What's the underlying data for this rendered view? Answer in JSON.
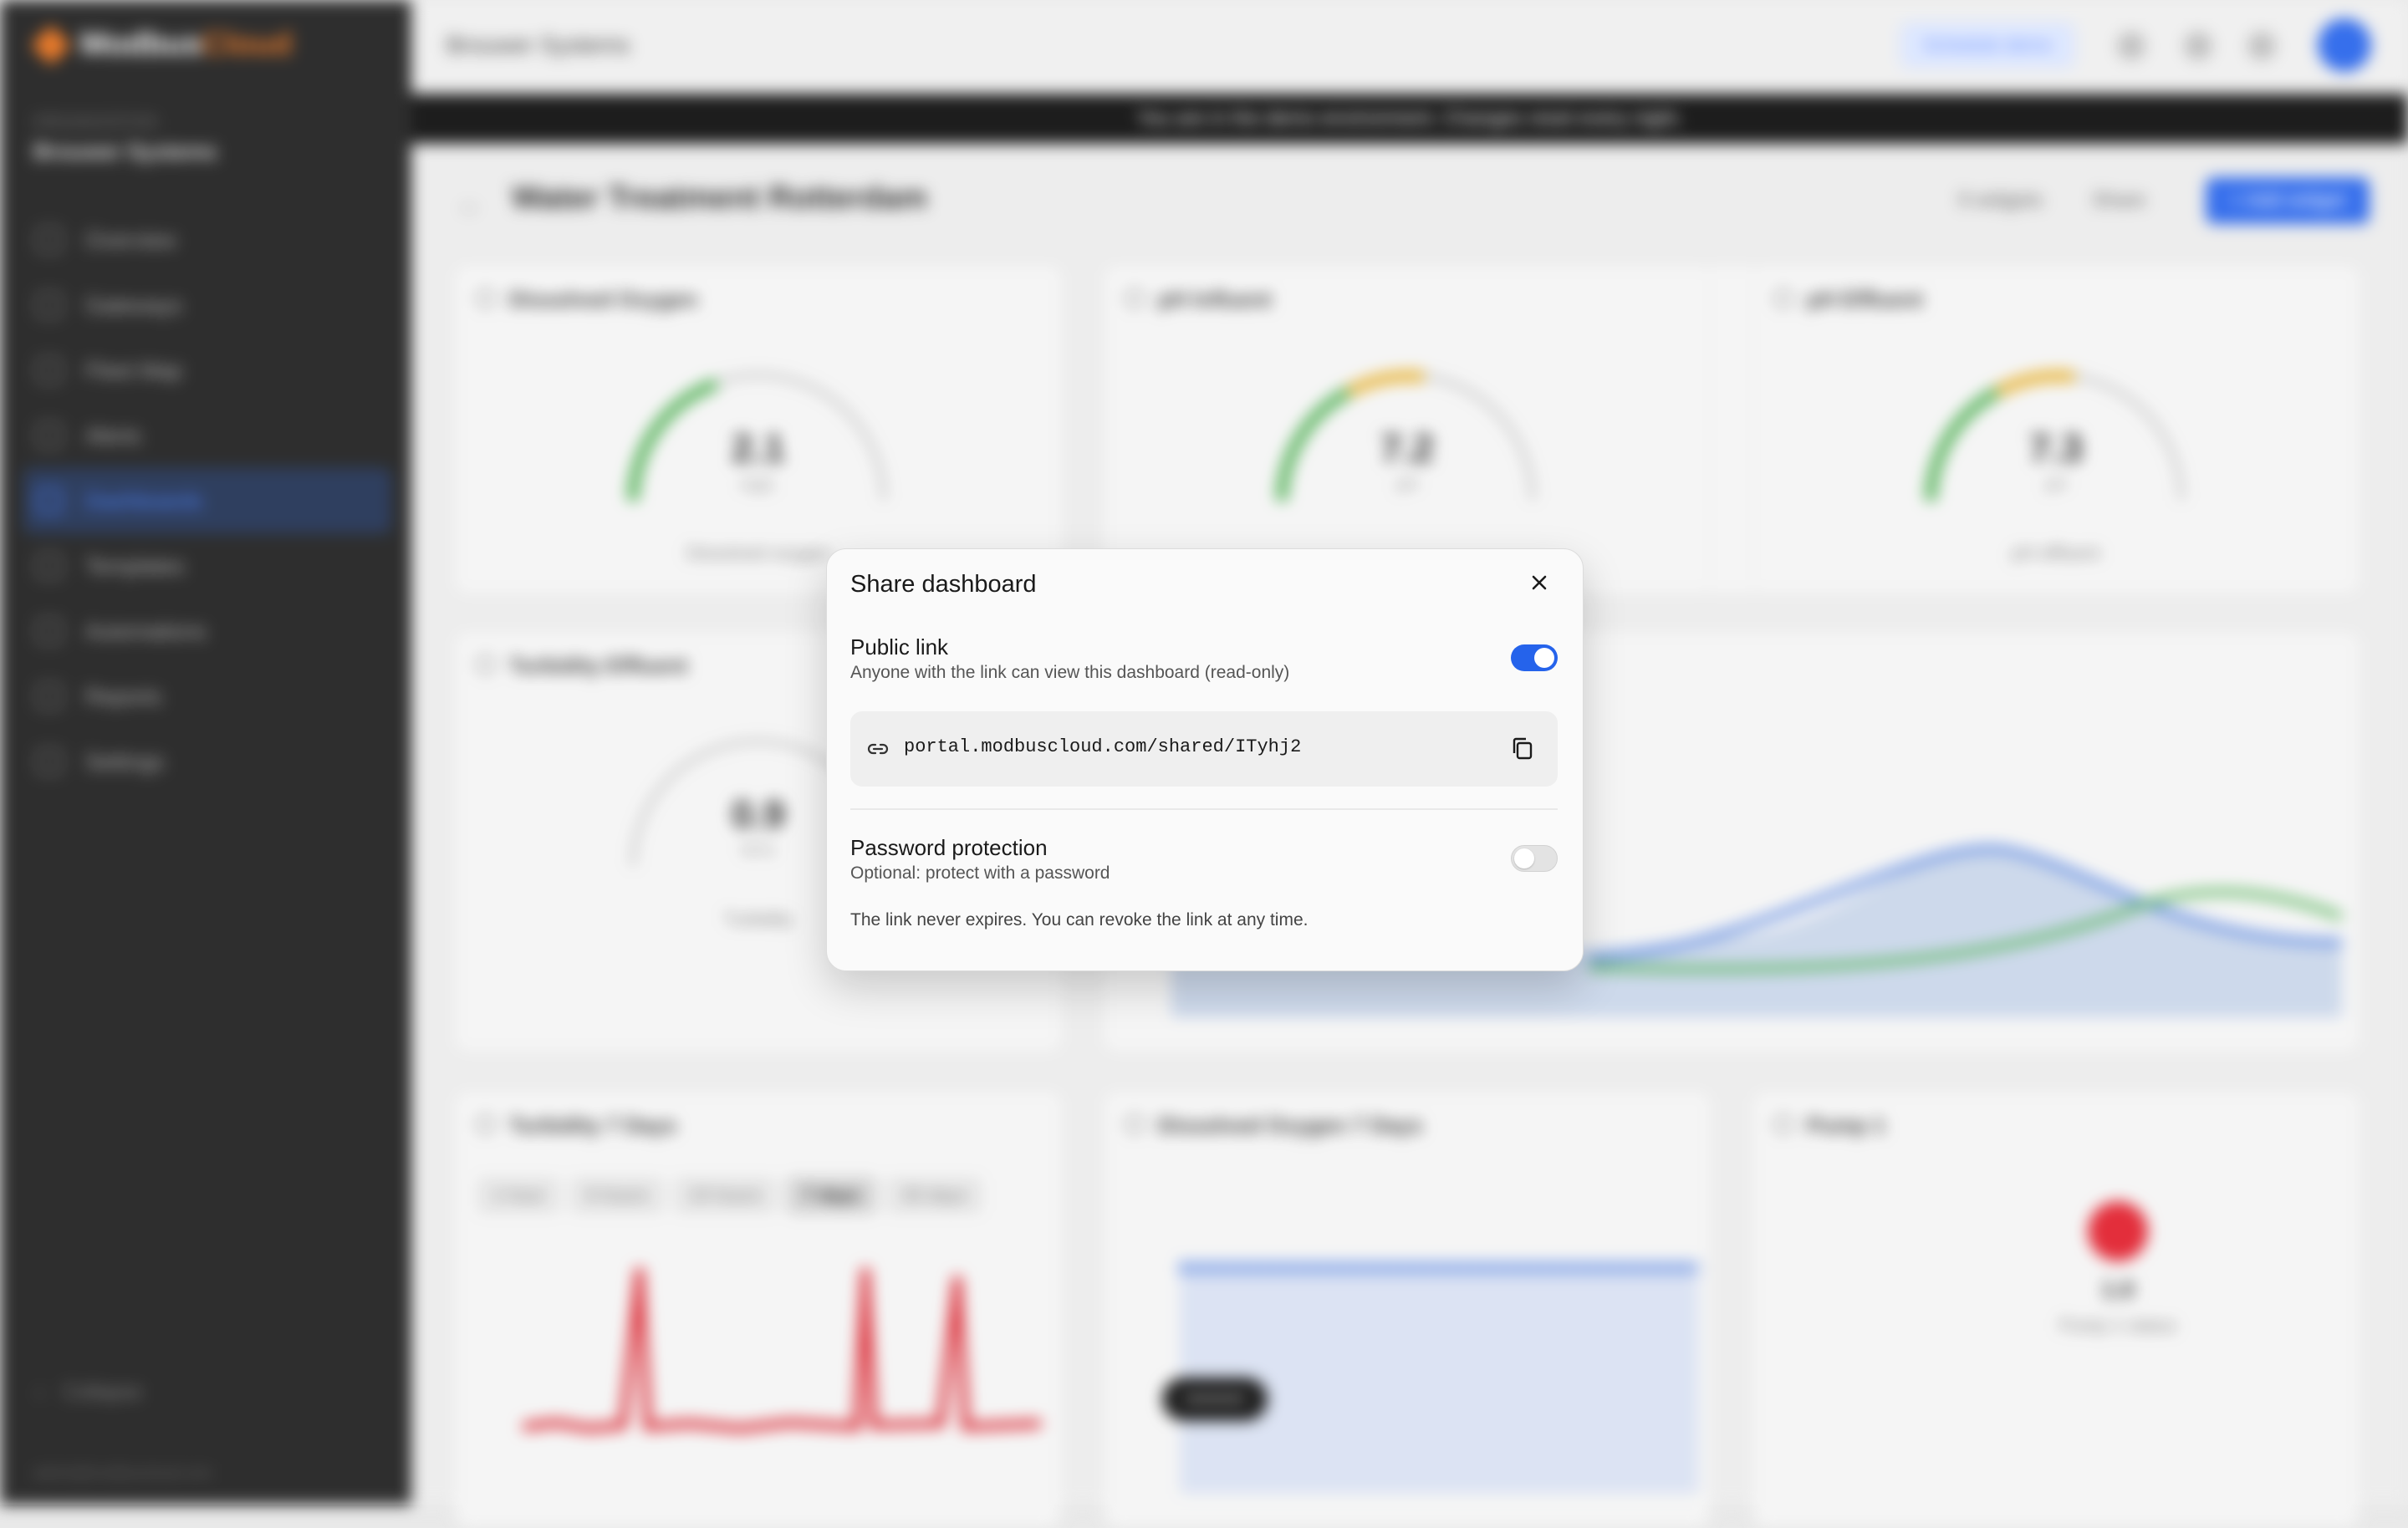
{
  "app": {
    "logo_primary": "Modbus",
    "logo_accent": "Cloud",
    "org_label": "ORGANIZATION",
    "org_name": "Brouwer Systems",
    "footer_email": "admin@modbuscloud.com"
  },
  "sidebar": {
    "items": [
      {
        "label": "Overview",
        "icon": "grid-icon"
      },
      {
        "label": "Gateways",
        "icon": "router-icon"
      },
      {
        "label": "Fleet Map",
        "icon": "map-icon"
      },
      {
        "label": "Alerts",
        "icon": "bell-icon"
      },
      {
        "label": "Dashboards",
        "icon": "gauge-icon"
      },
      {
        "label": "Templates",
        "icon": "template-icon"
      },
      {
        "label": "Automations",
        "icon": "bolt-icon"
      },
      {
        "label": "Reports",
        "icon": "report-icon"
      },
      {
        "label": "Settings",
        "icon": "gear-icon"
      }
    ],
    "collapse_label": "Collapse"
  },
  "topbar": {
    "breadcrumb": "Brouwer Systems",
    "demo_button": "Schedule demo",
    "banner": "You are in the demo environment. Changes reset every night."
  },
  "dashboard": {
    "title": "Water Treatment Rotterdam",
    "widgets_count": "9 widgets",
    "share_label": "Share",
    "add_widget_label": "+ Add widget",
    "gauges": [
      {
        "title": "Dissolved Oxygen",
        "value": "2.1",
        "unit": "mg/L",
        "caption": "Dissolved oxygen",
        "fraction": 0.35
      },
      {
        "title": "pH Influent",
        "value": "7.2",
        "unit": "pH",
        "caption": "pH influent",
        "fraction": 0.55
      },
      {
        "title": "pH Effluent",
        "value": "7.3",
        "unit": "pH",
        "caption": "pH effluent",
        "fraction": 0.56
      },
      {
        "title": "Turbidity Effluent",
        "value": "0.9",
        "unit": "NTU",
        "caption": "Turbidity",
        "fraction": 0.1
      }
    ],
    "bottom_cards": [
      {
        "title": "Turbidity 7 Days"
      },
      {
        "title": "Dissolved Oxygen 7 Days"
      },
      {
        "title": "Pump 1"
      }
    ],
    "range_tabs": [
      "1 hour",
      "6 hours",
      "24 hours",
      "7 days",
      "30 days"
    ],
    "selected_tab": "7 days",
    "pump": {
      "value": "1.0",
      "caption": "Pump 1 status",
      "status_color": "#e11d2b"
    },
    "toast": "••••••••••"
  },
  "share_modal": {
    "title": "Share dashboard",
    "public_link": {
      "title": "Public link",
      "description": "Anyone with the link can view this dashboard (read-only)",
      "enabled": true
    },
    "url": "portal.modbuscloud.com/shared/ITyhj2",
    "password": {
      "title": "Password protection",
      "description": "Optional: protect with a password",
      "enabled": false
    },
    "note": "The link never expires. You can revoke the link at any time."
  },
  "colors": {
    "accent": "#2563eb",
    "brand": "#e8701a",
    "sidebar_bg": "#1d1d1d",
    "alert_red": "#e11d2b"
  }
}
